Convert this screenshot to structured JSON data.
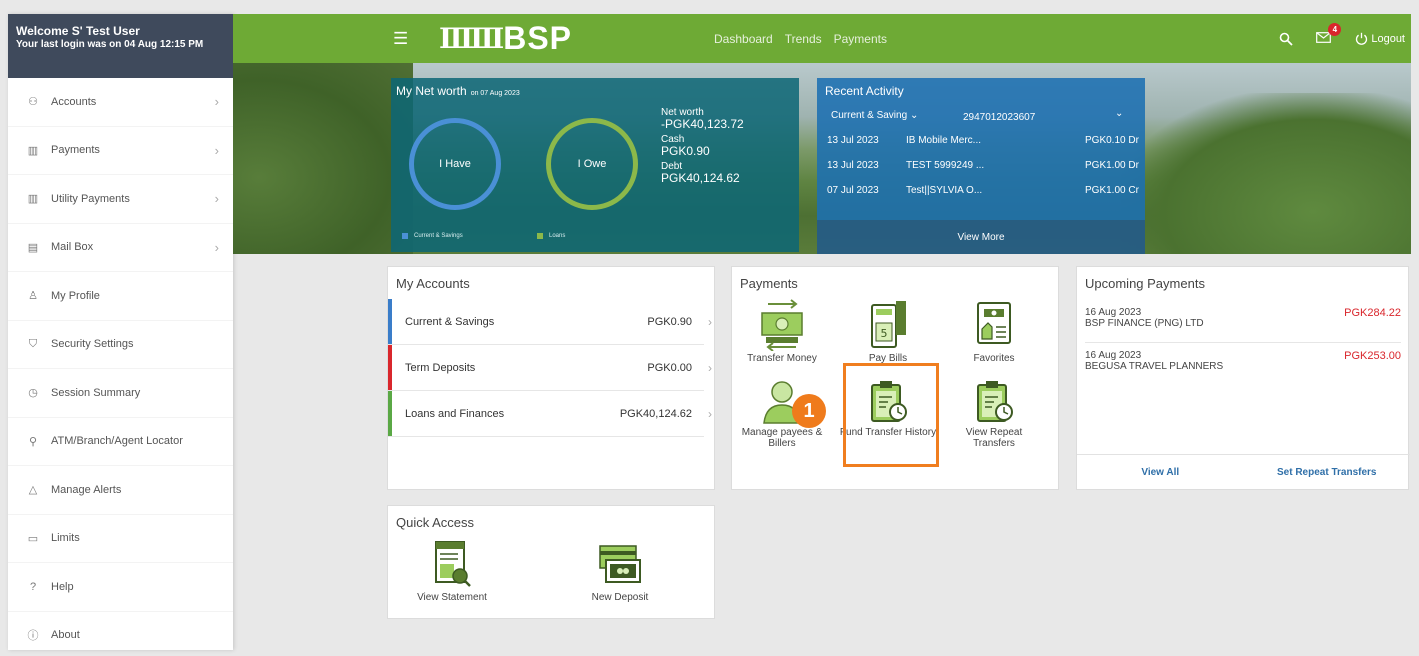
{
  "sidebar": {
    "welcome": "Welcome S' Test User",
    "last_login": "Your last login was on 04 Aug 12:15 PM",
    "items": [
      {
        "label": "Accounts",
        "icon": "accounts-icon",
        "glyph": "⚇",
        "chevron": true
      },
      {
        "label": "Payments",
        "icon": "payments-icon",
        "glyph": "▥",
        "chevron": true
      },
      {
        "label": "Utility Payments",
        "icon": "utility-payments-icon",
        "glyph": "▥",
        "chevron": true
      },
      {
        "label": "Mail Box",
        "icon": "mailbox-icon",
        "glyph": "▤",
        "chevron": true
      },
      {
        "label": "My Profile",
        "icon": "profile-icon",
        "glyph": "♙",
        "chevron": false
      },
      {
        "label": "Security Settings",
        "icon": "shield-icon",
        "glyph": "⛉",
        "chevron": false
      },
      {
        "label": "Session Summary",
        "icon": "clock-icon",
        "glyph": "◷",
        "chevron": false
      },
      {
        "label": "ATM/Branch/Agent Locator",
        "icon": "location-pin-icon",
        "glyph": "⚲",
        "chevron": false
      },
      {
        "label": "Manage Alerts",
        "icon": "alert-triangle-icon",
        "glyph": "△",
        "chevron": false
      },
      {
        "label": "Limits",
        "icon": "limits-icon",
        "glyph": "▭",
        "chevron": false
      },
      {
        "label": "Help",
        "icon": "help-icon",
        "glyph": "?",
        "chevron": false
      },
      {
        "label": "About",
        "icon": "info-icon",
        "glyph": "ⓘ",
        "chevron": false
      }
    ]
  },
  "topbar": {
    "logo_mark": "ⅢⅢ",
    "logo_text": "BSP",
    "nav": [
      "Dashboard",
      "Trends",
      "Payments"
    ],
    "mail_badge": "4",
    "logout": "Logout",
    "color": "#6eaa35"
  },
  "networth": {
    "title": "My Net worth",
    "date": "on 07 Aug 2023",
    "circle_have": "I Have",
    "circle_owe": "I Owe",
    "legend_have": "Current & Savings",
    "legend_owe": "Loans",
    "net_worth_label": "Net worth",
    "net_worth_value": "-PGK40,123.72",
    "cash_label": "Cash",
    "cash_value": "PGK0.90",
    "debt_label": "Debt",
    "debt_value": "PGK40,124.62"
  },
  "recent": {
    "title": "Recent Activity",
    "filter": "Current & Saving",
    "account": "2947012023607",
    "rows": [
      {
        "date": "13 Jul 2023",
        "desc": "IB Mobile Merc...",
        "amount": "PGK0.10 Dr"
      },
      {
        "date": "13 Jul 2023",
        "desc": "TEST 5999249 ...",
        "amount": "PGK1.00 Dr"
      },
      {
        "date": "07 Jul 2023",
        "desc": "Test||SYLVIA O...",
        "amount": "PGK1.00 Cr"
      }
    ],
    "view_more": "View More"
  },
  "accounts": {
    "title": "My Accounts",
    "rows": [
      {
        "name": "Current & Savings",
        "amount": "PGK0.90",
        "color": "#3a7dc9"
      },
      {
        "name": "Term Deposits",
        "amount": "PGK0.00",
        "color": "#d9262c"
      },
      {
        "name": "Loans and Finances",
        "amount": "PGK40,124.62",
        "color": "#5aa845"
      }
    ]
  },
  "payments": {
    "title": "Payments",
    "items": [
      {
        "label": "Transfer Money",
        "icon": "transfer-money-icon"
      },
      {
        "label": "Pay Bills",
        "icon": "pay-bills-icon"
      },
      {
        "label": "Favorites",
        "icon": "favorites-icon"
      },
      {
        "label": "Manage payees & Billers",
        "icon": "manage-payees-icon"
      },
      {
        "label": "Fund Transfer History",
        "icon": "fund-transfer-history-icon"
      },
      {
        "label": "View Repeat Transfers",
        "icon": "view-repeat-transfers-icon"
      }
    ],
    "step_number": "1",
    "highlight_color": "#f07e1f"
  },
  "upcoming": {
    "title": "Upcoming Payments",
    "items": [
      {
        "date": "16 Aug 2023",
        "payee": "BSP FINANCE (PNG) LTD",
        "amount": "PGK284.22"
      },
      {
        "date": "16 Aug 2023",
        "payee": "BEGUSA TRAVEL PLANNERS",
        "amount": "PGK253.00"
      }
    ],
    "view_all": "View All",
    "set_repeat": "Set Repeat Transfers"
  },
  "quick_access": {
    "title": "Quick Access",
    "items": [
      {
        "label": "View Statement",
        "icon": "view-statement-icon"
      },
      {
        "label": "New Deposit",
        "icon": "new-deposit-icon"
      }
    ]
  }
}
